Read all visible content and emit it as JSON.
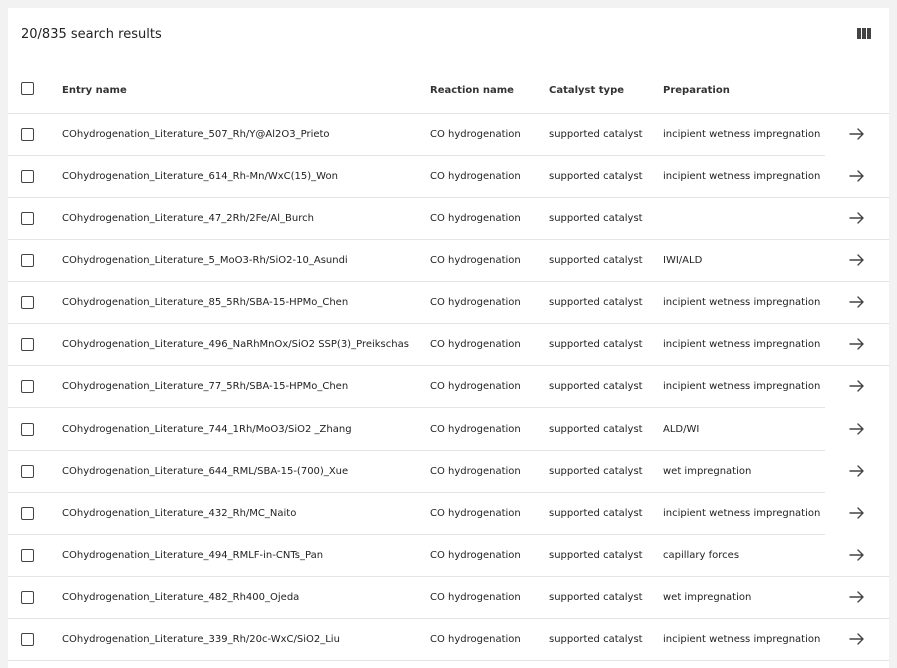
{
  "results_title": "20/835 search results",
  "icons": {
    "columns": "view-columns-icon",
    "open": "arrow-right-icon",
    "checkbox": "checkbox-icon"
  },
  "columns": {
    "entry_name": "Entry name",
    "reaction_name": "Reaction name",
    "catalyst_type": "Catalyst type",
    "preparation": "Preparation"
  },
  "rows": [
    {
      "entry": "COhydrogenation_Literature_507_Rh/Y@Al2O3_Prieto",
      "reaction": "CO hydrogenation",
      "catalyst": "supported catalyst",
      "preparation": "incipient wetness impregnation"
    },
    {
      "entry": "COhydrogenation_Literature_614_Rh-Mn/WxC(15)_Won",
      "reaction": "CO hydrogenation",
      "catalyst": "supported catalyst",
      "preparation": "incipient wetness impregnation"
    },
    {
      "entry": "COhydrogenation_Literature_47_2Rh/2Fe/Al_Burch",
      "reaction": "CO hydrogenation",
      "catalyst": "supported catalyst",
      "preparation": ""
    },
    {
      "entry": "COhydrogenation_Literature_5_MoO3-Rh/SiO2-10_Asundi",
      "reaction": "CO hydrogenation",
      "catalyst": "supported catalyst",
      "preparation": "IWI/ALD"
    },
    {
      "entry": "COhydrogenation_Literature_85_5Rh/SBA-15-HPMo_Chen",
      "reaction": "CO hydrogenation",
      "catalyst": "supported catalyst",
      "preparation": "incipient wetness impregnation"
    },
    {
      "entry": "COhydrogenation_Literature_496_NaRhMnOx/SiO2 SSP(3)_Preikschas",
      "reaction": "CO hydrogenation",
      "catalyst": "supported catalyst",
      "preparation": "incipient wetness impregnation"
    },
    {
      "entry": "COhydrogenation_Literature_77_5Rh/SBA-15-HPMo_Chen",
      "reaction": "CO hydrogenation",
      "catalyst": "supported catalyst",
      "preparation": "incipient wetness impregnation"
    },
    {
      "entry": "COhydrogenation_Literature_744_1Rh/MoO3/SiO2 _Zhang",
      "reaction": "CO hydrogenation",
      "catalyst": "supported catalyst",
      "preparation": "ALD/WI"
    },
    {
      "entry": "COhydrogenation_Literature_644_RML/SBA-15-(700)_Xue",
      "reaction": "CO hydrogenation",
      "catalyst": "supported catalyst",
      "preparation": "wet impregnation"
    },
    {
      "entry": "COhydrogenation_Literature_432_Rh/MC_Naito",
      "reaction": "CO hydrogenation",
      "catalyst": "supported catalyst",
      "preparation": "incipient wetness impregnation"
    },
    {
      "entry": "COhydrogenation_Literature_494_RMLF-in-CNTs_Pan",
      "reaction": "CO hydrogenation",
      "catalyst": "supported catalyst",
      "preparation": "capillary forces"
    },
    {
      "entry": "COhydrogenation_Literature_482_Rh400_Ojeda",
      "reaction": "CO hydrogenation",
      "catalyst": "supported catalyst",
      "preparation": "wet impregnation"
    },
    {
      "entry": "COhydrogenation_Literature_339_Rh/20c-WxC/SiO2_Liu",
      "reaction": "CO hydrogenation",
      "catalyst": "supported catalyst",
      "preparation": "incipient wetness impregnation"
    }
  ]
}
